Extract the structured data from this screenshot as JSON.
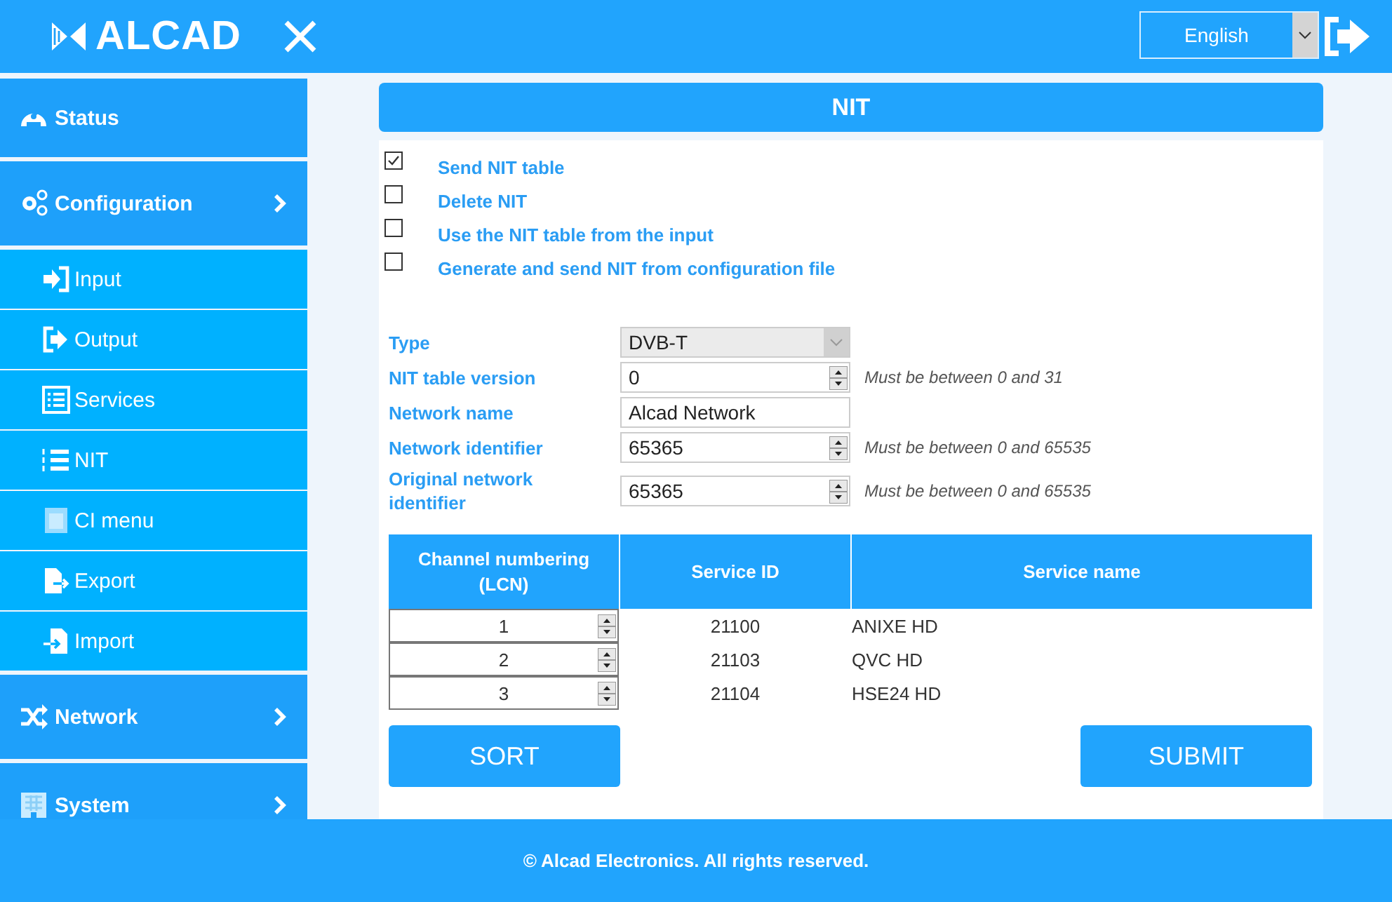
{
  "header": {
    "logo": "ALCAD",
    "language": "English"
  },
  "sidebar": {
    "items": [
      {
        "kind": "section",
        "label": "Status",
        "arrow": false
      },
      {
        "kind": "section",
        "label": "Configuration",
        "arrow": true
      },
      {
        "kind": "sub",
        "label": "Input"
      },
      {
        "kind": "sub",
        "label": "Output"
      },
      {
        "kind": "sub",
        "label": "Services"
      },
      {
        "kind": "sub",
        "label": "NIT"
      },
      {
        "kind": "sub",
        "label": "CI menu"
      },
      {
        "kind": "sub",
        "label": "Export"
      },
      {
        "kind": "sub",
        "label": "Import"
      },
      {
        "kind": "section",
        "label": "Network",
        "arrow": true
      },
      {
        "kind": "section",
        "label": "System",
        "arrow": true
      }
    ]
  },
  "page_title": "NIT",
  "options": [
    {
      "label": "Send NIT table",
      "checked": true
    },
    {
      "label": "Delete NIT",
      "checked": false
    },
    {
      "label": "Use the NIT table from the input",
      "checked": false
    },
    {
      "label": "Generate and send NIT from configuration file",
      "checked": false
    }
  ],
  "fields": [
    {
      "kind": "select",
      "label": "Type",
      "value": "DVB-T",
      "disabled": true
    },
    {
      "kind": "number",
      "label": "NIT table version",
      "value": "0",
      "hint": "Must be between 0 and 31"
    },
    {
      "kind": "text",
      "label": "Network name",
      "value": "Alcad Network"
    },
    {
      "kind": "number",
      "label": "Network identifier",
      "value": "65365",
      "hint": "Must be between 0 and 65535"
    },
    {
      "kind": "number",
      "label": "Original network identifier",
      "value": "65365",
      "hint": "Must be between 0 and 65535"
    }
  ],
  "table": {
    "columns": [
      "Channel numbering (LCN)",
      "Service ID",
      "Service name"
    ],
    "rows": [
      {
        "lcn": "1",
        "service_id": "21100",
        "service_name": "ANIXE HD"
      },
      {
        "lcn": "2",
        "service_id": "21103",
        "service_name": "QVC HD"
      },
      {
        "lcn": "3",
        "service_id": "21104",
        "service_name": "HSE24 HD"
      }
    ]
  },
  "buttons": [
    "SORT",
    "SUBMIT"
  ],
  "footer": "© Alcad Electronics. All rights reserved."
}
